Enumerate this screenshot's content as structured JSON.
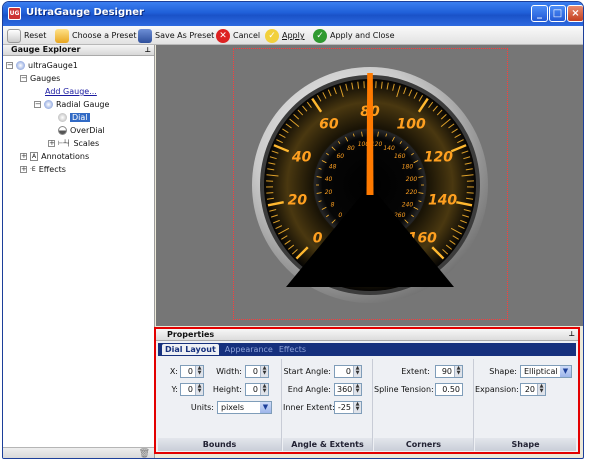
{
  "window": {
    "title": "UltraGauge Designer",
    "icon_text": "UG"
  },
  "toolbar": {
    "reset": "Reset",
    "choose_preset": "Choose a Preset",
    "save_preset": "Save As Preset",
    "cancel": "Cancel",
    "apply": "Apply",
    "apply_close": "Apply and Close"
  },
  "explorer": {
    "title": "Gauge Explorer",
    "root": "ultraGauge1",
    "gauges": "Gauges",
    "add_gauge": "Add Gauge...",
    "radial": "Radial Gauge",
    "dial": "Dial",
    "overdial": "OverDial",
    "scales": "Scales",
    "annotations": "Annotations",
    "effects": "Effects"
  },
  "gauge": {
    "outer_labels": [
      "0",
      "20",
      "40",
      "60",
      "80",
      "100",
      "120",
      "140",
      "160"
    ],
    "inner_labels": [
      "0",
      "8",
      "20",
      "40",
      "48",
      "60",
      "80",
      "100",
      "120",
      "140",
      "160",
      "180",
      "200",
      "220",
      "240",
      "260"
    ],
    "needle_value": 80,
    "accent_color": "#ff7a00",
    "tick_color": "#ffb830",
    "label_color": "#ffa020"
  },
  "properties": {
    "title": "Properties",
    "tabs": [
      "Dial Layout",
      "Appearance",
      "Effects"
    ],
    "bounds": {
      "header": "Bounds",
      "x_label": "X:",
      "x": "0",
      "y_label": "Y:",
      "y": "0",
      "width_label": "Width:",
      "width": "0",
      "height_label": "Height:",
      "height": "0",
      "units_label": "Units:",
      "units": "pixels"
    },
    "angles": {
      "header": "Angle & Extents",
      "start_label": "Start Angle:",
      "start": "0",
      "end_label": "End Angle:",
      "end": "360",
      "inner_label": "Inner Extent:",
      "inner": "-25"
    },
    "corners": {
      "header": "Corners",
      "extent_label": "Extent:",
      "extent": "90",
      "spline_label": "Spline Tension:",
      "spline": "0.50"
    },
    "shape": {
      "header": "Shape",
      "shape_label": "Shape:",
      "shape": "Elliptical",
      "expansion_label": "Expansion:",
      "expansion": "20"
    }
  }
}
